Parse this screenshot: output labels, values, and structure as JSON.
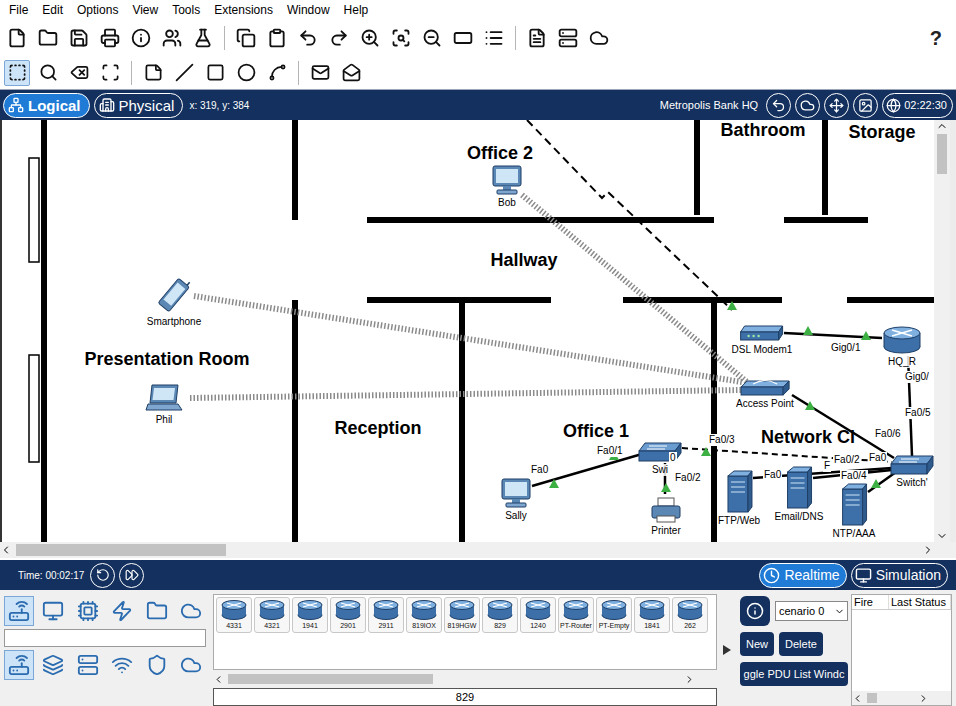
{
  "menu": [
    "File",
    "Edit",
    "Options",
    "View",
    "Tools",
    "Extensions",
    "Window",
    "Help"
  ],
  "help": "?",
  "edit_tools": [
    {
      "selected": true
    },
    {
      "selected": false
    },
    {
      "selected": false
    },
    {
      "selected": false
    },
    {
      "selected": false
    },
    {
      "selected": false
    },
    {
      "selected": false
    },
    {
      "selected": false
    },
    {
      "selected": false
    },
    {
      "selected": false
    },
    {
      "selected": false
    }
  ],
  "workspace_tabs": [
    {
      "label": "Logical",
      "selected": true
    },
    {
      "label": "Physical",
      "selected": false
    }
  ],
  "coords": "x: 319, y: 384",
  "workspace_name": "Metropolis Bank HQ",
  "clock": "02:22:30",
  "canvas": {
    "rooms": [
      "Office 2",
      "Bathroom",
      "Storage",
      "Hallway",
      "Presentation Room",
      "Reception",
      "Office 1",
      "Network Cl"
    ],
    "devices": [
      {
        "label": "Bob",
        "kind": "pc"
      },
      {
        "label": "Smartphone",
        "kind": "phone"
      },
      {
        "label": "Phil",
        "kind": "laptop"
      },
      {
        "label": "Sally",
        "kind": "pc"
      },
      {
        "label": "Swi",
        "kind": "switch"
      },
      {
        "label": "Printer",
        "kind": "printer"
      },
      {
        "label": "DSL Modem1",
        "kind": "modem"
      },
      {
        "label": "Access Point",
        "kind": "ap"
      },
      {
        "label": "HQ_R",
        "kind": "router"
      },
      {
        "label": "Switch'",
        "kind": "switch"
      },
      {
        "label": "FTP/Web",
        "kind": "server"
      },
      {
        "label": "Email/DNS",
        "kind": "server"
      },
      {
        "label": "NTP/AAA",
        "kind": "server"
      }
    ],
    "ports": [
      "Fa0",
      "Fa0/1",
      "0",
      "Fa0/2",
      "Fa0/3",
      "Fa0",
      "F",
      "Fa0/2",
      "Fa0/4",
      "Fa0",
      "Fa0/6",
      "Fa0/5",
      "Gig0/1",
      "Gig0/"
    ],
    "links": [
      {
        "kind": "wireless"
      },
      {
        "kind": "wireless"
      },
      {
        "kind": "wireless"
      },
      {
        "kind": "dsl"
      },
      {
        "kind": "copper"
      },
      {
        "kind": "copper"
      },
      {
        "kind": "copper"
      },
      {
        "kind": "copper"
      },
      {
        "kind": "copper"
      },
      {
        "kind": "crossover"
      },
      {
        "kind": "copper"
      },
      {
        "kind": "copper"
      },
      {
        "kind": "copper"
      }
    ]
  },
  "time": "Time: 00:02:17",
  "modes": [
    {
      "label": "Realtime",
      "selected": true
    },
    {
      "label": "Simulation",
      "selected": false
    }
  ],
  "categories": {
    "top": [
      {
        "selected": true
      },
      {
        "selected": false
      },
      {
        "selected": false
      },
      {
        "selected": false
      },
      {
        "selected": false
      },
      {
        "selected": false
      }
    ],
    "bottom": [
      {
        "selected": true
      },
      {
        "selected": false
      },
      {
        "selected": false
      },
      {
        "selected": false
      },
      {
        "selected": false
      },
      {
        "selected": false
      }
    ]
  },
  "device_types": [
    "4331",
    "4321",
    "1941",
    "2901",
    "2911",
    "819IOX",
    "819HGW",
    "829",
    "1240",
    "PT-Router",
    "PT-Empty",
    "1841",
    "262"
  ],
  "selected_device": "829",
  "scenario": {
    "value": "cenario 0",
    "buttons": [
      "New",
      "Delete"
    ],
    "pdu_toggle": "ggle PDU List Windc"
  },
  "pdu_table": {
    "columns": [
      "Fire",
      "Last Status"
    ]
  }
}
